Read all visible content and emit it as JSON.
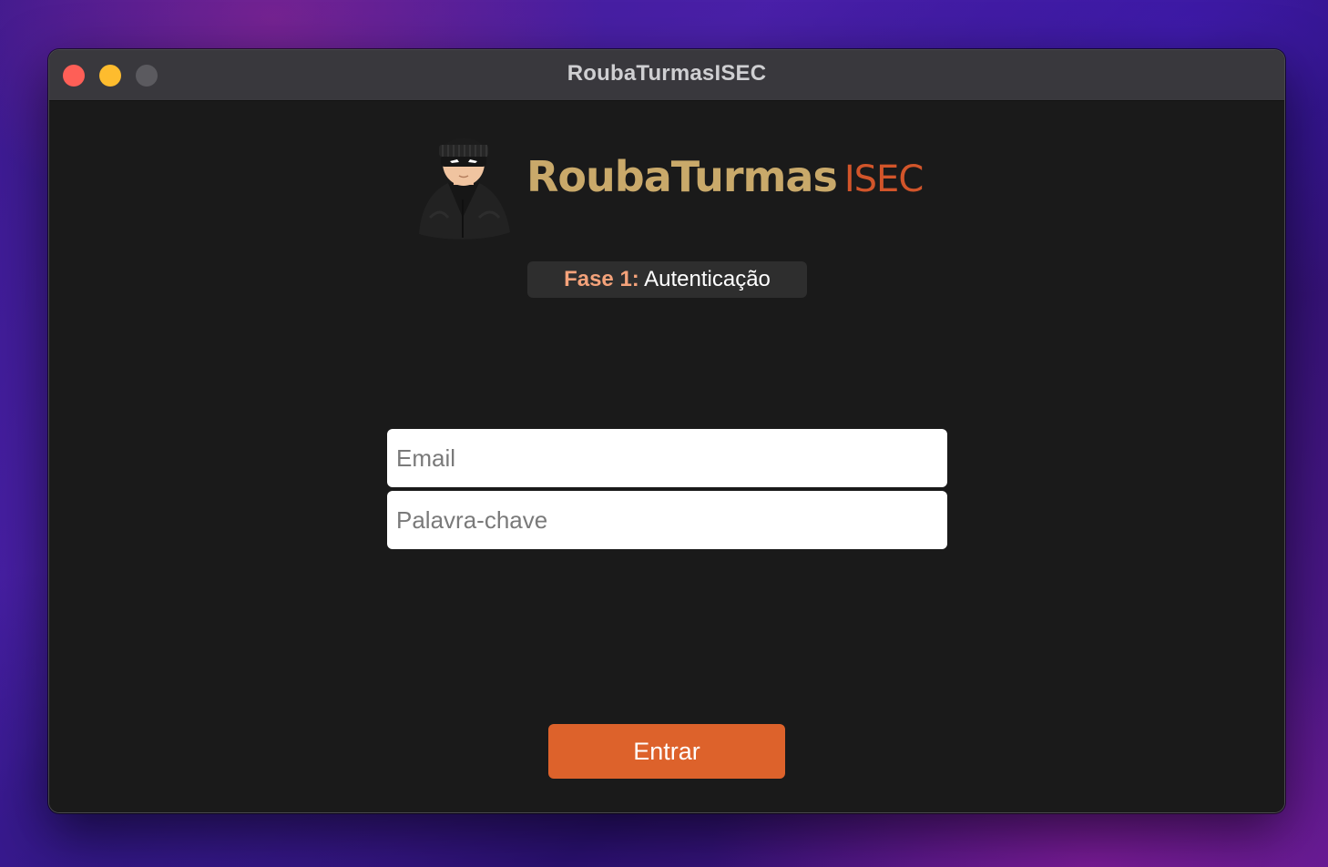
{
  "window": {
    "title": "RoubaTurmasISEC"
  },
  "logo": {
    "icon": "thief-mascot-icon",
    "main_text": "RoubaTurmas",
    "sub_text": "ISEC"
  },
  "phase": {
    "label": "Fase 1:",
    "name": "Autenticação"
  },
  "form": {
    "email_placeholder": "Email",
    "password_placeholder": "Palavra-chave",
    "email_value": "",
    "password_value": "",
    "submit_label": "Entrar"
  },
  "colors": {
    "accent": "#dd622b",
    "logo_gold": "#c9a96a",
    "logo_orange": "#d2552a",
    "phase_label": "#f4a27a",
    "background": "#1a1a1a"
  }
}
